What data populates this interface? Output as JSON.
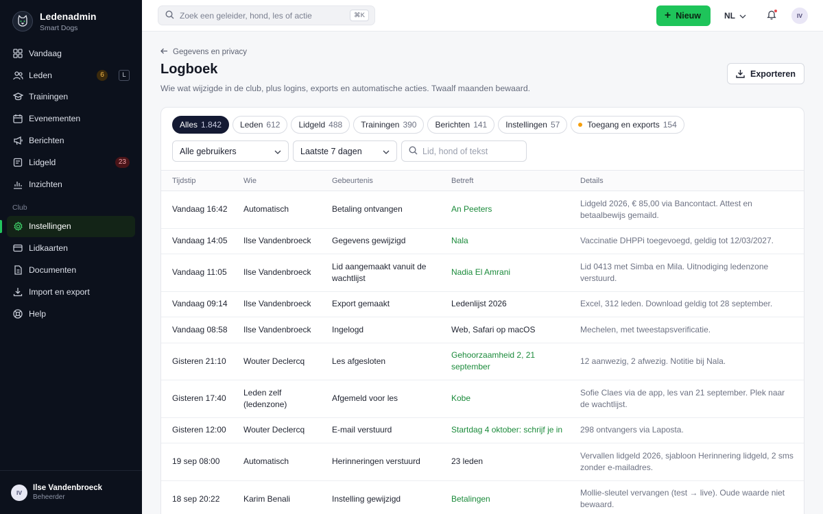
{
  "brand": {
    "name": "Ledenadmin",
    "sub": "Smart Dogs"
  },
  "nav": {
    "items": [
      {
        "id": "vandaag",
        "label": "Vandaag",
        "icon": "grid-icon"
      },
      {
        "id": "leden",
        "label": "Leden",
        "icon": "users-icon",
        "badge": "6",
        "kbd": "L"
      },
      {
        "id": "trainingen",
        "label": "Trainingen",
        "icon": "graduation-cap-icon"
      },
      {
        "id": "evenementen",
        "label": "Evenementen",
        "icon": "calendar-icon"
      },
      {
        "id": "berichten",
        "label": "Berichten",
        "icon": "megaphone-icon"
      },
      {
        "id": "lidgeld",
        "label": "Lidgeld",
        "icon": "wallet-icon",
        "badge": "23"
      },
      {
        "id": "inzichten",
        "label": "Inzichten",
        "icon": "bar-chart-icon"
      }
    ],
    "section_label": "Club",
    "club_items": [
      {
        "id": "instellingen",
        "label": "Instellingen",
        "icon": "gear-icon",
        "active": true
      },
      {
        "id": "lidkaarten",
        "label": "Lidkaarten",
        "icon": "id-card-icon"
      },
      {
        "id": "documenten",
        "label": "Documenten",
        "icon": "document-icon"
      },
      {
        "id": "import-export",
        "label": "Import en export",
        "icon": "download-icon"
      },
      {
        "id": "help",
        "label": "Help",
        "icon": "lifebuoy-icon"
      }
    ]
  },
  "user": {
    "initials": "IV",
    "name": "Ilse Vandenbroeck",
    "role": "Beheerder"
  },
  "topbar": {
    "search_placeholder": "Zoek een geleider, hond, les of actie",
    "search_kbd": "⌘K",
    "new_label": "Nieuw",
    "lang": "NL",
    "avatar": "IV"
  },
  "page": {
    "back_label": "Gegevens en privacy",
    "title": "Logboek",
    "description": "Wie wat wijzigde in de club, plus logins, exports en automatische acties. Twaalf maanden bewaard.",
    "export_label": "Exporteren"
  },
  "chips": [
    {
      "label": "Alles",
      "count": "1.842",
      "active": true
    },
    {
      "label": "Leden",
      "count": "612"
    },
    {
      "label": "Lidgeld",
      "count": "488"
    },
    {
      "label": "Trainingen",
      "count": "390"
    },
    {
      "label": "Berichten",
      "count": "141"
    },
    {
      "label": "Instellingen",
      "count": "57"
    },
    {
      "label": "Toegang en exports",
      "count": "154",
      "dot": true
    }
  ],
  "filters": {
    "users": "Alle gebruikers",
    "period": "Laatste 7 dagen",
    "search_placeholder": "Lid, hond of tekst"
  },
  "table": {
    "headers": [
      "Tijdstip",
      "Wie",
      "Gebeurtenis",
      "Betreft",
      "Details"
    ],
    "rows": [
      {
        "time": "Vandaag 16:42",
        "who": "Automatisch",
        "event": "Betaling ontvangen",
        "subject": "An Peeters",
        "link": true,
        "details": "Lidgeld 2026, € 85,00 via Bancontact. Attest en betaalbewijs gemaild.",
        "tall": true
      },
      {
        "time": "Vandaag 14:05",
        "who": "Ilse Vandenbroeck",
        "event": "Gegevens gewijzigd",
        "subject": "Nala",
        "link": true,
        "details": "Vaccinatie DHPPi toegevoegd, geldig tot 12/03/2027.",
        "tall": false
      },
      {
        "time": "Vandaag 11:05",
        "who": "Ilse Vandenbroeck",
        "event": "Lid aangemaakt vanuit de wachtlijst",
        "subject": "Nadia El Amrani",
        "link": true,
        "details": "Lid 0413 met Simba en Mila. Uitnodiging ledenzone verstuurd.",
        "tall": true
      },
      {
        "time": "Vandaag 09:14",
        "who": "Ilse Vandenbroeck",
        "event": "Export gemaakt",
        "subject": "Ledenlijst 2026",
        "link": false,
        "details": "Excel, 312 leden. Download geldig tot 28 september.",
        "tall": false
      },
      {
        "time": "Vandaag 08:58",
        "who": "Ilse Vandenbroeck",
        "event": "Ingelogd",
        "subject": "Web, Safari op macOS",
        "link": false,
        "details": "Mechelen, met tweestapsverificatie.",
        "tall": false
      },
      {
        "time": "Gisteren 21:10",
        "who": "Wouter Declercq",
        "event": "Les afgesloten",
        "subject": "Gehoorzaamheid 2, 21 september",
        "link": true,
        "details": "12 aanwezig, 2 afwezig. Notitie bij Nala.",
        "tall": true
      },
      {
        "time": "Gisteren 17:40",
        "who": "Leden zelf (ledenzone)",
        "event": "Afgemeld voor les",
        "subject": "Kobe",
        "link": true,
        "details": "Sofie Claes via de app, les van 21 september. Plek naar de wachtlijst.",
        "tall": true
      },
      {
        "time": "Gisteren 12:00",
        "who": "Wouter Declercq",
        "event": "E-mail verstuurd",
        "subject": "Startdag 4 oktober: schrijf je in",
        "link": true,
        "details": "298 ontvangers via Laposta.",
        "tall": false
      },
      {
        "time": "19 sep 08:00",
        "who": "Automatisch",
        "event": "Herinneringen verstuurd",
        "subject": "23 leden",
        "link": false,
        "details": "Vervallen lidgeld 2026, sjabloon Herinnering lidgeld, 2 sms zonder e-mailadres.",
        "tall": true
      },
      {
        "time": "18 sep 20:22",
        "who": "Karim Benali",
        "event": "Instelling gewijzigd",
        "subject": "Betalingen",
        "link": true,
        "details": "Mollie-sleutel vervangen (test → live). Oude waarde niet bewaard.",
        "tall": true
      }
    ]
  }
}
